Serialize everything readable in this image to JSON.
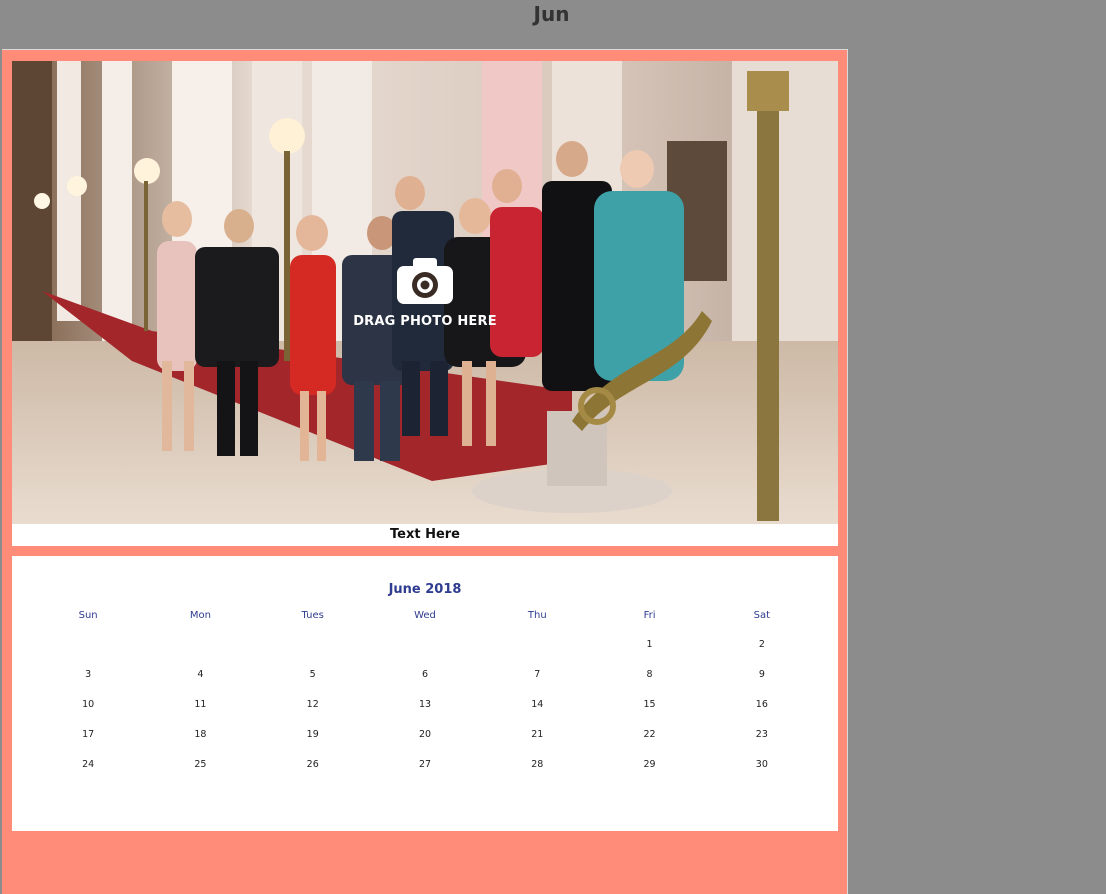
{
  "header": {
    "month_label": "Jun"
  },
  "photo": {
    "drop_label": "DRAG PHOTO HERE",
    "caption": "Text Here"
  },
  "calendar": {
    "title": "June 2018",
    "weekdays": [
      "Sun",
      "Mon",
      "Tues",
      "Wed",
      "Thu",
      "Fri",
      "Sat"
    ],
    "days": [
      "",
      "",
      "",
      "",
      "",
      "1",
      "2",
      "3",
      "4",
      "5",
      "6",
      "7",
      "8",
      "9",
      "10",
      "11",
      "12",
      "13",
      "14",
      "15",
      "16",
      "17",
      "18",
      "19",
      "20",
      "21",
      "22",
      "23",
      "24",
      "25",
      "26",
      "27",
      "28",
      "29",
      "30"
    ]
  },
  "colors": {
    "background": "#8c8c8c",
    "page_accent": "#ff8c78",
    "calendar_text": "#2f3c8f"
  },
  "icons": {
    "drop_icon": "camera-icon"
  }
}
